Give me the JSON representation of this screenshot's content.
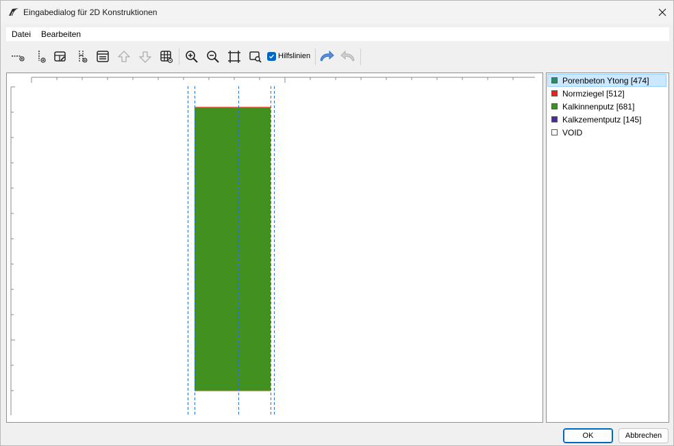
{
  "window": {
    "title": "Eingabedialog für 2D Konstruktionen"
  },
  "menu": {
    "items": [
      {
        "label": "Datei"
      },
      {
        "label": "Bearbeiten"
      }
    ]
  },
  "toolbar": {
    "buttons": [
      {
        "icon": "horizontal-line-point-icon",
        "enabled": true
      },
      {
        "icon": "vertical-line-point-icon",
        "enabled": true
      },
      {
        "icon": "edit-layer-icon",
        "enabled": true
      },
      {
        "icon": "split-vertical-icon",
        "enabled": true
      },
      {
        "icon": "layer-list-icon",
        "enabled": true
      },
      {
        "icon": "arrow-up-icon",
        "enabled": false
      },
      {
        "icon": "arrow-down-icon",
        "enabled": false
      },
      {
        "icon": "grid-settings-icon",
        "enabled": true
      },
      {
        "icon": "zoom-in-icon",
        "enabled": true
      },
      {
        "icon": "zoom-out-icon",
        "enabled": true
      },
      {
        "icon": "zoom-fit-icon",
        "enabled": true
      },
      {
        "icon": "zoom-window-icon",
        "enabled": true
      },
      {
        "icon": "undo-icon",
        "enabled": true
      },
      {
        "icon": "redo-icon",
        "enabled": false
      }
    ],
    "hilfslinien": {
      "label": "Hilfslinien",
      "checked": true
    }
  },
  "legend": {
    "items": [
      {
        "label": "Porenbeton Ytong [474]",
        "color": "#2e8b6a",
        "selected": true
      },
      {
        "label": "Normziegel [512]",
        "color": "#e8231c",
        "selected": false
      },
      {
        "label": "Kalkinnenputz [681]",
        "color": "#3f8f22",
        "selected": false
      },
      {
        "label": "Kalkzementputz [145]",
        "color": "#4b2a9c",
        "selected": false
      },
      {
        "label": "VOID",
        "color": "#ffffff",
        "selected": false
      }
    ]
  },
  "canvas": {
    "fill_color": "#42901f",
    "edge_color": "#ff7a6a",
    "guide_color": "#2a6fd0"
  },
  "buttons": {
    "ok": "OK",
    "cancel": "Abbrechen"
  }
}
